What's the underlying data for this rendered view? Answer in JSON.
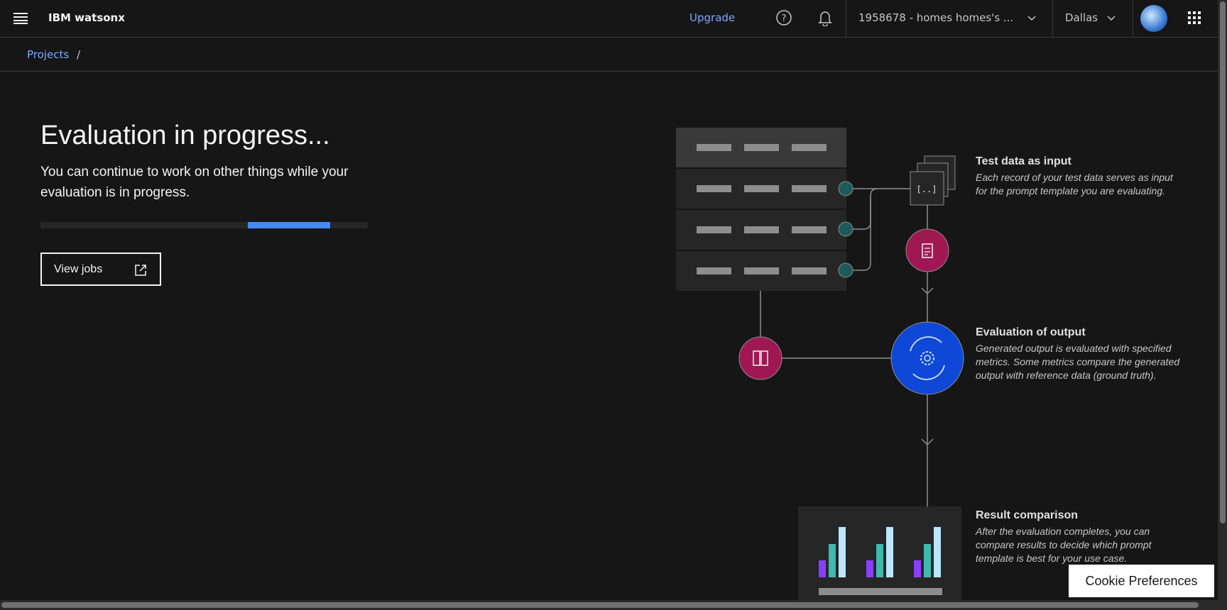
{
  "header": {
    "menu_icon": "hamburger-icon",
    "app_name": "IBM watsonx",
    "upgrade": "Upgrade",
    "help_icon": "help-icon",
    "notification_icon": "bell-icon",
    "account": "1958678 - homes homes's ...",
    "region": "Dallas",
    "avatar": "user-avatar",
    "switcher_icon": "app-switcher-icon"
  },
  "breadcrumb": {
    "items": [
      {
        "label": "Projects"
      }
    ],
    "separator": "/"
  },
  "main": {
    "title": "Evaluation in progress...",
    "subtitle": "You can continue to work on other things while your evaluation is in progress.",
    "progress": "indeterminate",
    "view_jobs": "View jobs",
    "view_jobs_icon": "launch-icon"
  },
  "diagram": {
    "steps": [
      {
        "title": "Test data as input",
        "description": "Each record of your test data serves as input for the prompt template you are evaluating."
      },
      {
        "title": "Evaluation of output",
        "description": "Generated output is evaluated with specified metrics. Some metrics compare the generated output with reference data (ground truth)."
      },
      {
        "title": "Result comparison",
        "description": "After the evaluation completes, you can compare results to decide which prompt template is best for your use case."
      }
    ],
    "colors": {
      "magenta": "#9f1853",
      "blue": "#0f48d6",
      "teal": "#1f5a5a",
      "chart_purple": "#8a3ffc",
      "chart_teal": "#3ebab0",
      "chart_light": "#bae6ff"
    }
  },
  "cookie": {
    "label": "Cookie Preferences"
  }
}
